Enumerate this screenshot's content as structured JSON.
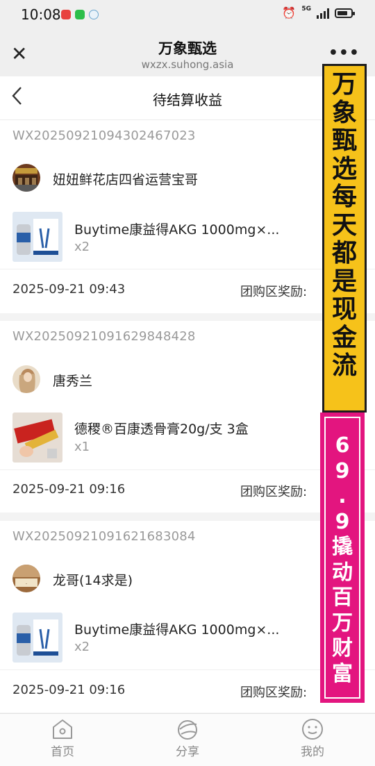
{
  "status_bar": {
    "time": "10:08",
    "network": "5G",
    "battery_level": 0.8,
    "icons": [
      "notification-app-icon",
      "wechat-icon",
      "browser-icon",
      "alarm-icon",
      "signal-icon",
      "battery-icon"
    ]
  },
  "app_header": {
    "title": "万象甄选",
    "url": "wxzx.suhong.asia",
    "close_icon": "✕",
    "more_icon": "•••"
  },
  "page": {
    "back_icon": "‹",
    "title": "待结算收益"
  },
  "orders": [
    {
      "order_no": "WX20250921094302467023",
      "buyer": "妞妞鲜花店四省运营宝哥",
      "product": "Buytime康益得AKG 1000mg×...",
      "qty": "x2",
      "time": "2025-09-21 09:43",
      "reward_label": "团购区奖励:"
    },
    {
      "order_no": "WX20250921091629848428",
      "buyer": "唐秀兰",
      "product": "德稷®百康透骨膏20g/支 3盒",
      "qty": "x1",
      "time": "2025-09-21 09:16",
      "reward_label": "团购区奖励:"
    },
    {
      "order_no": "WX20250921091621683084",
      "buyer": "龙哥(14求是)",
      "product": "Buytime康益得AKG 1000mg×...",
      "qty": "x2",
      "time": "2025-09-21 09:16",
      "reward_label": "团购区奖励:"
    }
  ],
  "banners": {
    "yellow": "万象甄选每天都是现金流",
    "pink": "69.9撬动百万财富",
    "yellow_color": "#f6c21a",
    "pink_color": "#e3157f"
  },
  "tabs": [
    {
      "label": "首页",
      "icon": "home-icon"
    },
    {
      "label": "分享",
      "icon": "share-icon"
    },
    {
      "label": "我的",
      "icon": "profile-icon"
    }
  ]
}
